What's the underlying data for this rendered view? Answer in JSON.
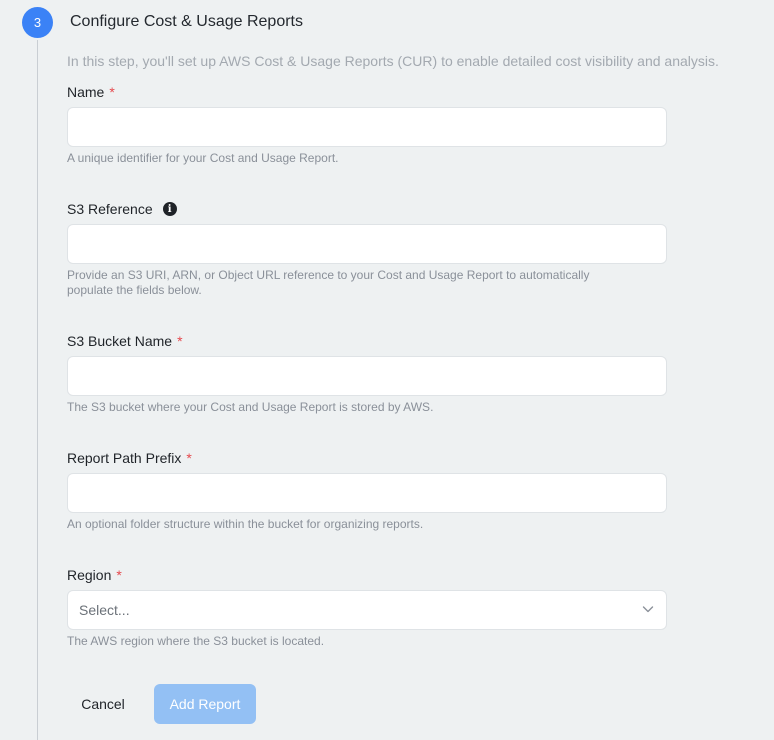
{
  "step": {
    "number": "3",
    "title": "Configure Cost & Usage Reports",
    "intro": "In this step, you'll set up AWS Cost & Usage Reports (CUR) to enable detailed cost visibility and analysis."
  },
  "form": {
    "required_marker": "*",
    "name": {
      "label": "Name",
      "value": "",
      "help": "A unique identifier for your Cost and Usage Report."
    },
    "s3_reference": {
      "label": "S3 Reference",
      "info_icon": "info-icon",
      "value": "",
      "help": "Provide an S3 URI, ARN, or Object URL reference to your Cost and Usage Report to automatically populate the fields below."
    },
    "s3_bucket_name": {
      "label": "S3 Bucket Name",
      "value": "",
      "help": "The S3 bucket where your Cost and Usage Report is stored by AWS."
    },
    "report_path_prefix": {
      "label": "Report Path Prefix",
      "value": "",
      "help": "An optional folder structure within the bucket for organizing reports."
    },
    "region": {
      "label": "Region",
      "selected": "Select...",
      "help": "The AWS region where the S3 bucket is located."
    }
  },
  "actions": {
    "cancel_label": "Cancel",
    "add_label": "Add Report"
  },
  "colors": {
    "accent": "#3b82f6",
    "button_disabled": "#93c0f4",
    "required": "#e5484d",
    "background": "#eef1f2"
  }
}
